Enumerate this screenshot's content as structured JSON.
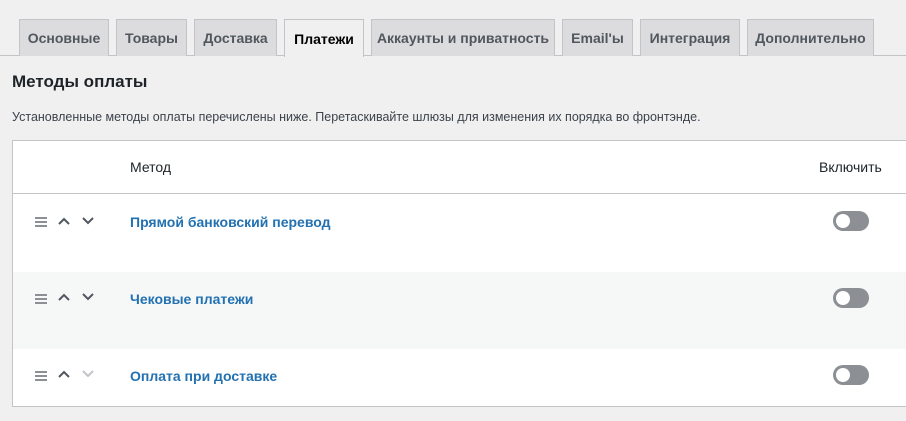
{
  "tabs": [
    {
      "label": "Основные"
    },
    {
      "label": "Товары"
    },
    {
      "label": "Доставка"
    },
    {
      "label": "Платежи",
      "active": true
    },
    {
      "label": "Аккаунты и приватность"
    },
    {
      "label": "Email'ы"
    },
    {
      "label": "Интеграция"
    },
    {
      "label": "Дополнительно"
    }
  ],
  "section": {
    "title": "Методы оплаты",
    "description": "Установленные методы оплаты перечислены ниже. Перетаскивайте шлюзы для изменения их порядка во фронтэнде."
  },
  "table": {
    "col_method": "Метод",
    "col_enable": "Включить",
    "rows": [
      {
        "name": "Прямой банковский перевод",
        "enabled": false
      },
      {
        "name": "Чековые платежи",
        "enabled": false
      },
      {
        "name": "Оплата при доставке",
        "enabled": false
      }
    ]
  },
  "colors": {
    "link": "#2271b1",
    "toggle_off": "#8c8f94",
    "tab_bg": "#dcdcde",
    "page_bg": "#f0f0f1"
  }
}
